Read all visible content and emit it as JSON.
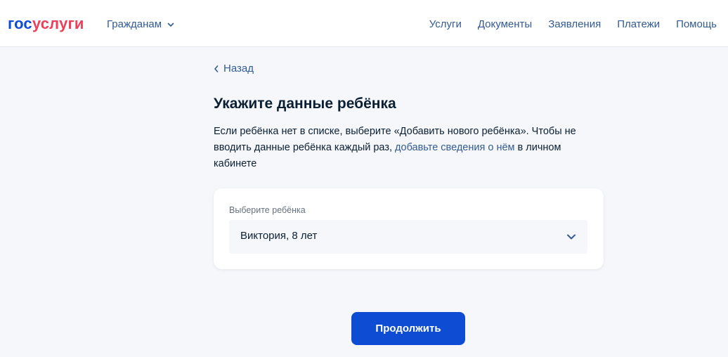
{
  "header": {
    "logo_part1": "гос",
    "logo_part2": "услуги",
    "audience_label": "Гражданам",
    "nav": [
      "Услуги",
      "Документы",
      "Заявления",
      "Платежи",
      "Помощь"
    ]
  },
  "back_label": "Назад",
  "page_title": "Укажите данные ребёнка",
  "description": {
    "text_before": "Если ребёнка нет в списке, выберите «Добавить нового ребёнка». Чтобы не вводить данные ребёнка каждый раз, ",
    "link": "добавьте сведения о нём",
    "text_after": " в личном кабинете"
  },
  "child_select": {
    "label": "Выберите ребёнка",
    "value": "Виктория, 8 лет"
  },
  "continue_button": "Продолжить",
  "colors": {
    "brand_blue": "#0d4cd3",
    "brand_red": "#ee3f58",
    "link": "#335b93",
    "background": "#f5f7fb"
  },
  "icons": {
    "audience_dropdown": "chevron-down-icon",
    "back": "chevron-left-icon",
    "select": "chevron-down-icon"
  }
}
